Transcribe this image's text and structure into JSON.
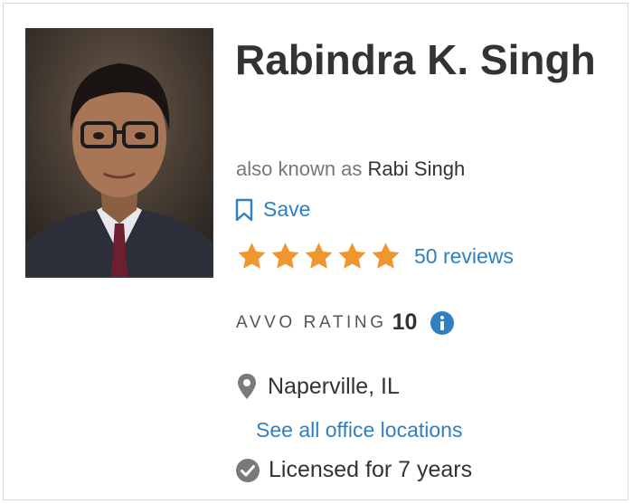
{
  "profile": {
    "name": "Rabindra K. Singh",
    "aka_prefix": "also known as",
    "aka_name": "Rabi Singh",
    "save_label": "Save",
    "stars": 5,
    "reviews_label": "50 reviews",
    "avvo_label": "AVVO RATING",
    "avvo_score": "10",
    "location": "Naperville, IL",
    "office_link": "See all office locations",
    "licensed": "Licensed for 7 years"
  },
  "colors": {
    "star": "#f0962f",
    "link": "#2f7fc1",
    "info": "#2f7fc1",
    "icon_gray": "#7a7a7a"
  },
  "icons": [
    "bookmark-icon",
    "star-icon",
    "info-icon",
    "map-pin-icon",
    "check-circle-icon"
  ]
}
